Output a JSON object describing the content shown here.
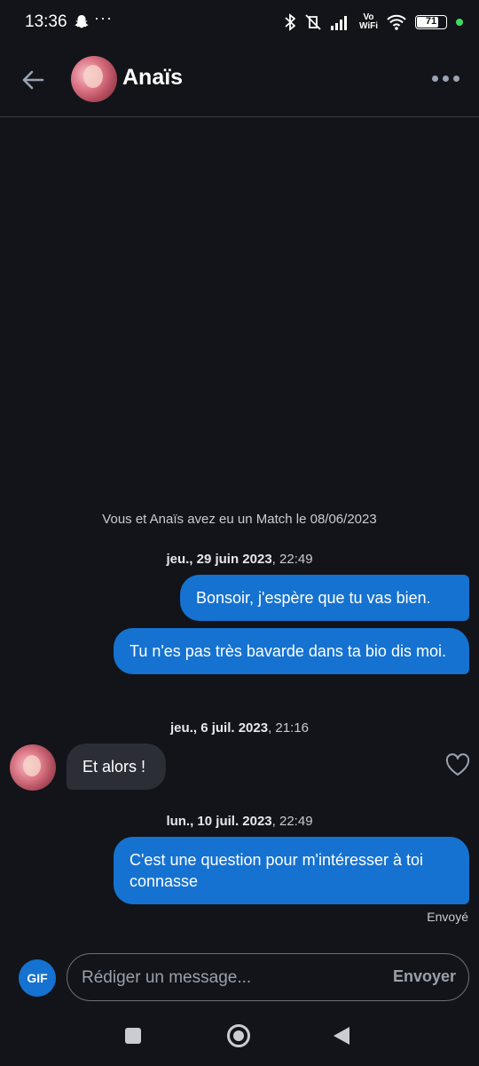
{
  "status_bar": {
    "time": "13:36",
    "dots": "···",
    "vowifi_line1": "Vo",
    "vowifi_line2": "WiFi",
    "battery": "71"
  },
  "header": {
    "contact_name": "Anaïs"
  },
  "conversation": {
    "match_notice": "Vous et Anaïs avez eu un Match le 08/06/2023",
    "groups": [
      {
        "date": "jeu., 29 juin 2023",
        "time": "22:49"
      },
      {
        "date": "jeu., 6 juil. 2023",
        "time": "21:16"
      },
      {
        "date": "lun., 10 juil. 2023",
        "time": "22:49"
      }
    ],
    "messages": [
      {
        "direction": "out",
        "text": "Bonsoir, j'espère que tu vas bien."
      },
      {
        "direction": "out",
        "text": "Tu n'es pas très bavarde dans ta bio dis moi."
      },
      {
        "direction": "in",
        "text": "Et alors !"
      },
      {
        "direction": "out",
        "text": "C'est une question pour m'intéresser à toi connasse"
      }
    ],
    "delivery_status": "Envoyé"
  },
  "composer": {
    "gif_label": "GIF",
    "placeholder": "Rédiger un message...",
    "send_label": "Envoyer"
  },
  "colors": {
    "background": "#121419",
    "outgoing_bubble": "#1572d0",
    "incoming_bubble": "#2b2e35"
  },
  "icons": {
    "back": "arrow-left-icon",
    "more": "more-horizontal-icon",
    "like": "heart-outline-icon"
  }
}
